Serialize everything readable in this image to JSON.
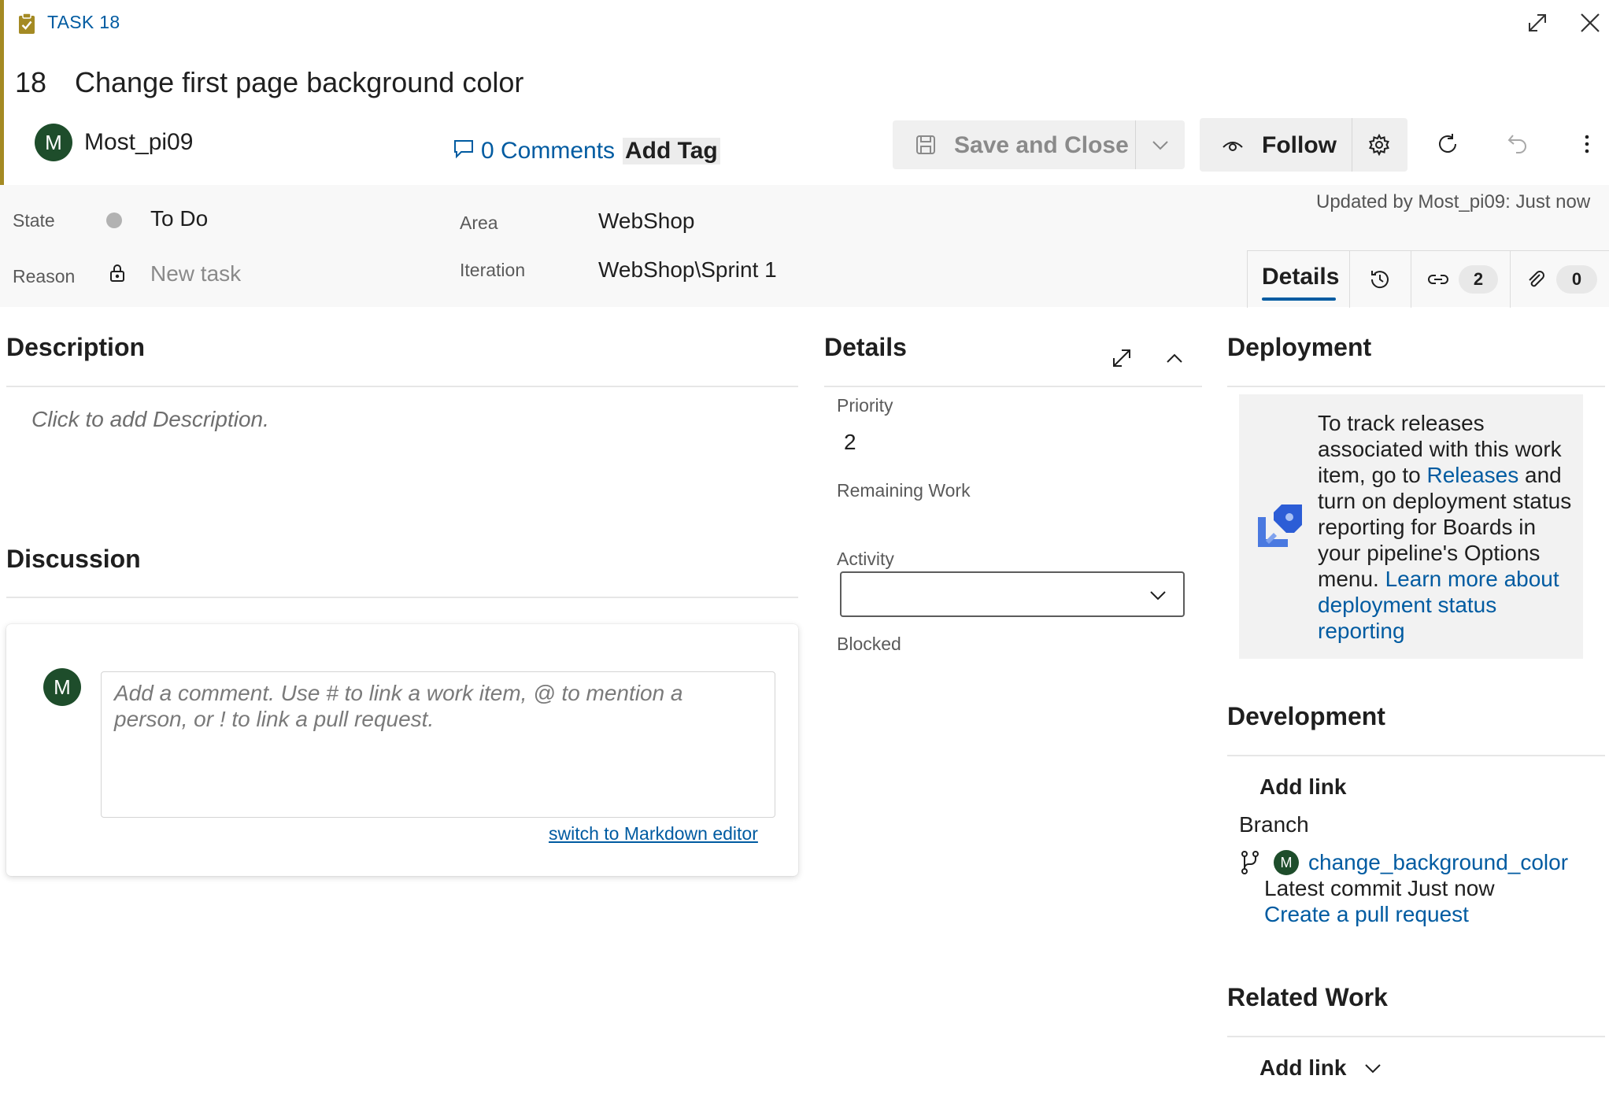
{
  "header": {
    "task_label": "TASK 18",
    "work_item_id": "18",
    "title": "Change first page background color",
    "assignee": {
      "initial": "M",
      "name": "Most_pi09"
    },
    "comments_label": "0 Comments",
    "add_tag_label": "Add Tag",
    "save_close_label": "Save and Close",
    "follow_label": "Follow"
  },
  "infobar": {
    "updated_text": "Updated by Most_pi09: Just now",
    "state_label": "State",
    "state_value": "To Do",
    "reason_label": "Reason",
    "reason_value": "New task",
    "area_label": "Area",
    "area_value": "WebShop",
    "iteration_label": "Iteration",
    "iteration_value": "WebShop\\Sprint 1",
    "tabs": {
      "details": "Details",
      "links_count": "2",
      "attachments_count": "0"
    }
  },
  "description": {
    "title": "Description",
    "placeholder": "Click to add Description."
  },
  "discussion": {
    "title": "Discussion",
    "avatar_initial": "M",
    "comment_placeholder": "Add a comment. Use # to link a work item, @ to mention a person, or ! to link a pull request.",
    "markdown_link": "switch to Markdown editor"
  },
  "details": {
    "title": "Details",
    "priority_label": "Priority",
    "priority_value": "2",
    "remaining_work_label": "Remaining Work",
    "activity_label": "Activity",
    "activity_value": "",
    "blocked_label": "Blocked"
  },
  "deployment": {
    "title": "Deployment",
    "text_1": "To track releases associated with this work item, go to ",
    "releases_link": "Releases",
    "text_2": " and turn on deployment status reporting for Boards in your pipeline's Options menu. ",
    "learn_link": "Learn more about deployment status reporting"
  },
  "development": {
    "title": "Development",
    "add_link_label": "Add link",
    "branch_label": "Branch",
    "branch_avatar_initial": "M",
    "branch_name": "change_background_color",
    "latest_commit": "Latest commit Just now",
    "create_pr_link": "Create a pull request"
  },
  "related_work": {
    "title": "Related Work",
    "add_link_label": "Add link"
  },
  "colors": {
    "accent": "#a48a23",
    "link": "#005ba1",
    "avatar": "#1e4d2b"
  }
}
